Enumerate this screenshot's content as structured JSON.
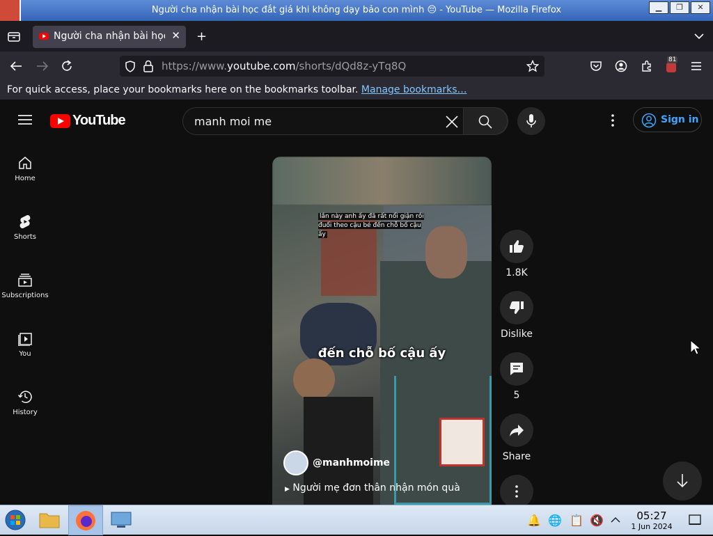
{
  "window": {
    "title": "Người cha nhận bài học đắt giá khi không dạy bảo con mình 😔 - YouTube — Mozilla Firefox"
  },
  "tabs": [
    {
      "label": "Người cha nhận bài học đắt giá khi không dạy bảo con mình 😔 - YouTube"
    }
  ],
  "navbar": {
    "url_prefix": "https://www.",
    "url_domain": "youtube.com",
    "url_path": "/shorts/dQd8z-yTq8Q",
    "extension_badge": "81"
  },
  "bookmarks_bar": {
    "message": "For quick access, place your bookmarks here on the bookmarks toolbar.",
    "link": "Manage bookmarks…"
  },
  "youtube": {
    "logo_text": "YouTube",
    "search_value": "manh moi me",
    "signin_label": "Sign in",
    "guide": [
      {
        "label": "Home",
        "icon": "home-icon"
      },
      {
        "label": "Shorts",
        "icon": "shorts-icon"
      },
      {
        "label": "Subscriptions",
        "icon": "subscriptions-icon"
      },
      {
        "label": "You",
        "icon": "you-icon"
      },
      {
        "label": "History",
        "icon": "history-icon"
      }
    ],
    "short": {
      "caption_top": "lần này anh ấy đã rất nổi giận rồi đuổi theo cậu bé đến chỗ bố cậu ấy",
      "caption_big": "đến chỗ bố cậu ấy",
      "channel": "@manhmoime",
      "song": "Người mẹ đơn thân nhận món quà"
    },
    "actions": [
      {
        "label": "1.8K",
        "icon": "like-icon"
      },
      {
        "label": "Dislike",
        "icon": "dislike-icon"
      },
      {
        "label": "5",
        "icon": "comment-icon"
      },
      {
        "label": "Share",
        "icon": "share-icon"
      }
    ]
  },
  "taskbar": {
    "time": "05:27",
    "date": "1 Jun 2024"
  },
  "colors": {
    "yt_background": "#0f0f0f",
    "yt_red": "#ff0000",
    "signin_blue": "#3ea6ff",
    "firefox_toolbar": "#2b2a33"
  }
}
